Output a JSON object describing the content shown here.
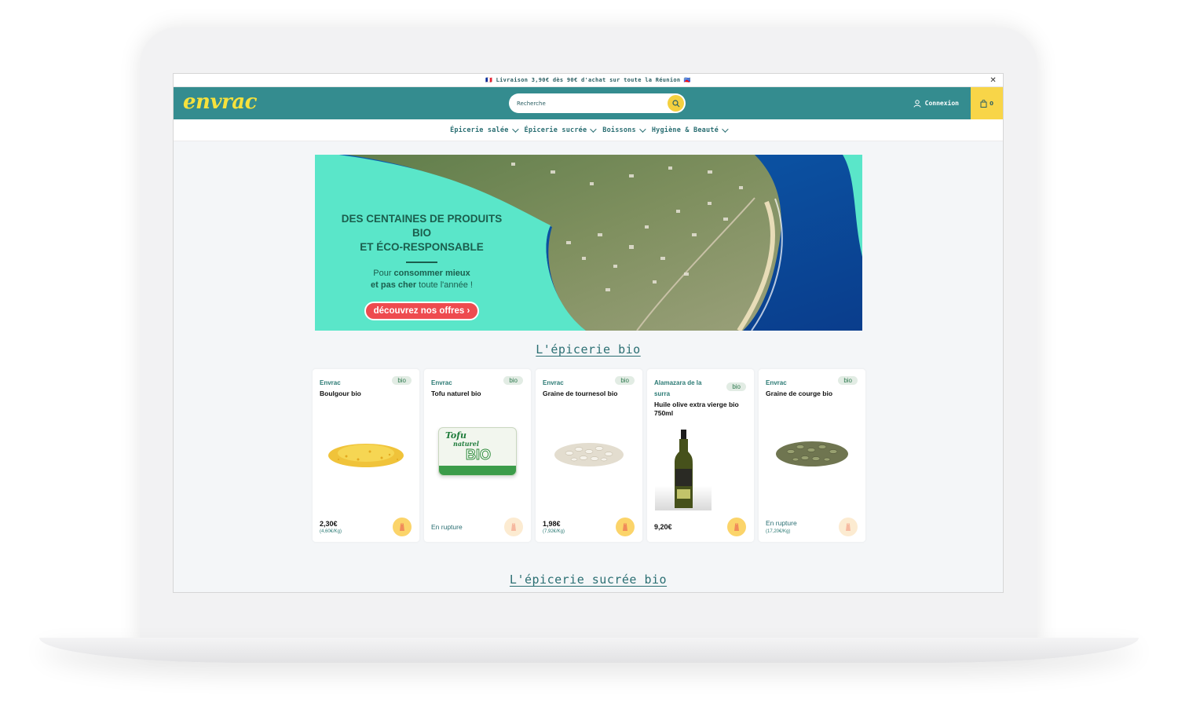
{
  "announcement": {
    "text": "🇫🇷 Livraison 3,90€ dès 90€ d'achat sur toute la Réunion 🇷🇪",
    "close": "✕"
  },
  "header": {
    "logo": "envrac",
    "search_placeholder": "Recherche",
    "login_label": "Connexion",
    "cart_count": "0"
  },
  "nav": {
    "items": [
      {
        "label": "Épicerie salée"
      },
      {
        "label": "Épicerie sucrée"
      },
      {
        "label": "Boissons"
      },
      {
        "label": "Hygiène & Beauté"
      }
    ]
  },
  "hero": {
    "title_line1": "DES CENTAINES DE PRODUITS BIO",
    "title_line2": "ET ÉCO-RESPONSABLE",
    "sub_line1_a": "Pour ",
    "sub_line1_b": "consommer mieux",
    "sub_line2_a": "et pas cher",
    "sub_line2_b": " toute l'année !",
    "cta": "découvrez nos offres ›"
  },
  "sections": {
    "epicerie_bio": "L'épicerie bio",
    "epicerie_sucree_bio": "L'épicerie sucrée bio"
  },
  "products": [
    {
      "brand": "Envrac",
      "badge": "bio",
      "name": "Boulgour bio",
      "price": "2,30€",
      "unit": "(4,60€/Kg)",
      "stock": "",
      "image": "bulgur-grains"
    },
    {
      "brand": "Envrac",
      "badge": "bio",
      "name": "Tofu naturel bio",
      "price": "",
      "unit": "",
      "stock": "En rupture",
      "image": "tofu-pack"
    },
    {
      "brand": "Envrac",
      "badge": "bio",
      "name": "Graine de tournesol bio",
      "price": "1,98€",
      "unit": "(7,92€/Kg)",
      "stock": "",
      "image": "sunflower-seeds"
    },
    {
      "brand": "Alamazara de la surra",
      "badge": "bio",
      "name": "Huile olive extra vierge bio 750ml",
      "price": "9,20€",
      "unit": "",
      "stock": "",
      "image": "olive-oil-bottle"
    },
    {
      "brand": "Envrac",
      "badge": "bio",
      "name": "Graine de courge bio",
      "price": "",
      "unit": "(17,20€/Kg)",
      "stock": "En rupture",
      "image": "pumpkin-seeds"
    }
  ],
  "tofu_label": {
    "l1": "Tofu",
    "l2": "naturel",
    "l3": "BIO"
  },
  "colors": {
    "header": "#348c8f",
    "accent": "#f6e13c",
    "cart": "#f8d548",
    "hero_bg": "#5ae6c9",
    "cta": "#ee4b4f"
  }
}
